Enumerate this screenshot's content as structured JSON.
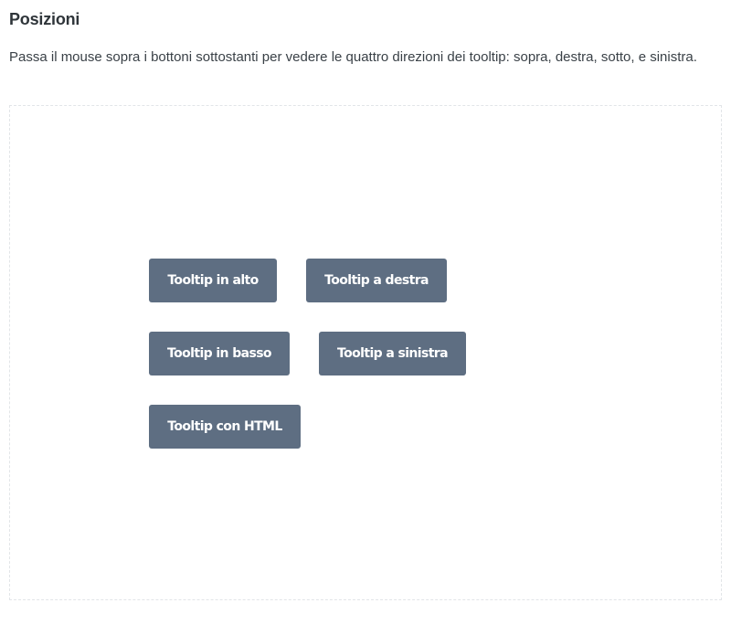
{
  "section": {
    "title": "Posizioni",
    "description": "Passa il mouse sopra i bottoni sottostanti per vedere le quattro direzioni dei tooltip: sopra, destra, sotto, e sinistra."
  },
  "buttons": {
    "top": "Tooltip in alto",
    "right": "Tooltip a destra",
    "bottom": "Tooltip in basso",
    "left": "Tooltip a sinistra",
    "html": "Tooltip con HTML"
  },
  "colors": {
    "button_bg": "#5e6e82",
    "button_text": "#ffffff",
    "box_border": "#e2e5e8"
  }
}
